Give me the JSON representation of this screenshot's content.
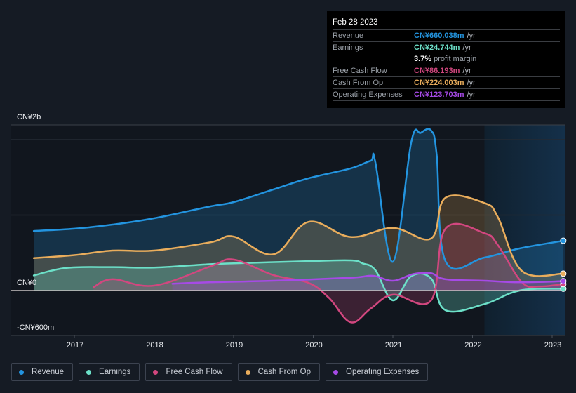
{
  "tooltip": {
    "date": "Feb 28 2023",
    "rows": [
      {
        "label": "Revenue",
        "value": "CN¥660.038m",
        "unit": "/yr",
        "color": "#2394df"
      },
      {
        "label": "Earnings",
        "value": "CN¥24.744m",
        "unit": "/yr",
        "color": "#6ce0c8"
      },
      {
        "label": "",
        "margin_value": "3.7%",
        "margin_text": "profit margin"
      },
      {
        "label": "Free Cash Flow",
        "value": "CN¥86.193m",
        "unit": "/yr",
        "color": "#d2477f"
      },
      {
        "label": "Cash From Op",
        "value": "CN¥224.003m",
        "unit": "/yr",
        "color": "#e9ad5c"
      },
      {
        "label": "Operating Expenses",
        "value": "CN¥123.703m",
        "unit": "/yr",
        "color": "#a64ae6"
      }
    ]
  },
  "legend": [
    {
      "label": "Revenue",
      "color": "#2394df"
    },
    {
      "label": "Earnings",
      "color": "#6ce0c8"
    },
    {
      "label": "Free Cash Flow",
      "color": "#d2477f"
    },
    {
      "label": "Cash From Op",
      "color": "#e9ad5c"
    },
    {
      "label": "Operating Expenses",
      "color": "#a64ae6"
    }
  ],
  "chart_data": {
    "type": "area",
    "title": "",
    "xlabel": "",
    "ylabel": "",
    "currency": "CN¥",
    "y_unit": "millions",
    "ylim": [
      -600,
      2195
    ],
    "xlim": [
      2016.17,
      2023.16
    ],
    "y_tick_labels": [
      {
        "value": 2000,
        "label": "CN¥2b"
      },
      {
        "value": 0,
        "label": "CN¥0"
      },
      {
        "value": -600,
        "label": "-CN¥600m"
      }
    ],
    "gridlines_at": [
      2000,
      1000,
      0
    ],
    "x_ticks": [
      {
        "value": 2017,
        "label": "2017"
      },
      {
        "value": 2018,
        "label": "2018"
      },
      {
        "value": 2019,
        "label": "2019"
      },
      {
        "value": 2020,
        "label": "2020"
      },
      {
        "value": 2021,
        "label": "2021"
      },
      {
        "value": 2022,
        "label": "2022"
      },
      {
        "value": 2023,
        "label": "2023"
      }
    ],
    "highlight_region": [
      2022.15,
      2023.16
    ],
    "legend_position": "bottom",
    "series": [
      {
        "name": "Revenue",
        "color": "#2394df",
        "points": [
          [
            2016.49,
            790
          ],
          [
            2017.0,
            820
          ],
          [
            2017.48,
            874
          ],
          [
            2018.0,
            958
          ],
          [
            2018.71,
            1116
          ],
          [
            2019.0,
            1172
          ],
          [
            2019.5,
            1340
          ],
          [
            2019.94,
            1488
          ],
          [
            2020.47,
            1619
          ],
          [
            2020.72,
            1720
          ],
          [
            2020.78,
            1700
          ],
          [
            2021.0,
            381
          ],
          [
            2021.23,
            1963
          ],
          [
            2021.35,
            2090
          ],
          [
            2021.48,
            2121
          ],
          [
            2021.55,
            1800
          ],
          [
            2021.66,
            391
          ],
          [
            2022.15,
            437
          ],
          [
            2022.59,
            558
          ],
          [
            2023.14,
            660
          ]
        ]
      },
      {
        "name": "Earnings",
        "color": "#6ce0c8",
        "points": [
          [
            2016.49,
            200
          ],
          [
            2016.9,
            300
          ],
          [
            2017.48,
            310
          ],
          [
            2018.0,
            305
          ],
          [
            2018.71,
            350
          ],
          [
            2019.0,
            360
          ],
          [
            2019.94,
            390
          ],
          [
            2020.47,
            400
          ],
          [
            2020.62,
            360
          ],
          [
            2020.78,
            270
          ],
          [
            2021.0,
            -130
          ],
          [
            2021.23,
            190
          ],
          [
            2021.48,
            160
          ],
          [
            2021.66,
            -260
          ],
          [
            2022.15,
            -180
          ],
          [
            2022.59,
            0
          ],
          [
            2023.14,
            25
          ]
        ]
      },
      {
        "name": "Free Cash Flow",
        "color": "#d2477f",
        "points": [
          [
            2017.24,
            45
          ],
          [
            2017.48,
            150
          ],
          [
            2018.0,
            65
          ],
          [
            2018.71,
            320
          ],
          [
            2019.0,
            410
          ],
          [
            2019.5,
            205
          ],
          [
            2019.94,
            102
          ],
          [
            2020.2,
            -100
          ],
          [
            2020.47,
            -420
          ],
          [
            2020.72,
            -240
          ],
          [
            2021.0,
            -55
          ],
          [
            2021.48,
            -130
          ],
          [
            2021.66,
            820
          ],
          [
            2022.15,
            760
          ],
          [
            2022.32,
            600
          ],
          [
            2022.62,
            110
          ],
          [
            2022.84,
            55
          ],
          [
            2023.14,
            86
          ]
        ]
      },
      {
        "name": "Cash From Op",
        "color": "#e9ad5c",
        "points": [
          [
            2016.49,
            430
          ],
          [
            2017.0,
            470
          ],
          [
            2017.48,
            530
          ],
          [
            2018.0,
            530
          ],
          [
            2018.71,
            640
          ],
          [
            2019.0,
            715
          ],
          [
            2019.5,
            480
          ],
          [
            2019.94,
            910
          ],
          [
            2020.47,
            710
          ],
          [
            2021.0,
            830
          ],
          [
            2021.48,
            690
          ],
          [
            2021.66,
            1230
          ],
          [
            2022.15,
            1160
          ],
          [
            2022.32,
            970
          ],
          [
            2022.62,
            260
          ],
          [
            2023.14,
            224
          ]
        ]
      },
      {
        "name": "Operating Expenses",
        "color": "#a64ae6",
        "points": [
          [
            2018.23,
            90
          ],
          [
            2018.71,
            110
          ],
          [
            2019.5,
            130
          ],
          [
            2020.47,
            170
          ],
          [
            2020.75,
            195
          ],
          [
            2021.0,
            130
          ],
          [
            2021.26,
            220
          ],
          [
            2021.48,
            230
          ],
          [
            2021.66,
            150
          ],
          [
            2022.15,
            130
          ],
          [
            2022.59,
            110
          ],
          [
            2023.14,
            124
          ]
        ]
      }
    ]
  }
}
